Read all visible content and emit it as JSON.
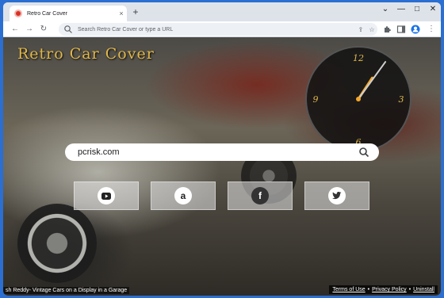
{
  "browser": {
    "tab_title": "Retro Car Cover",
    "tab_close": "×",
    "new_tab": "+",
    "minimize": "—",
    "maximize": "□",
    "close": "✕",
    "address_placeholder": "Search Retro Car Cover or type a URL"
  },
  "page": {
    "title": "Retro Car Cover",
    "search_value": "pcrisk.com",
    "clock": {
      "numerals": [
        "12",
        "3",
        "6",
        "9"
      ],
      "hour": 1,
      "minute": 6
    },
    "tiles": [
      {
        "name": "youtube",
        "icon": "youtube-icon"
      },
      {
        "name": "amazon",
        "icon": "amazon-icon",
        "glyph": "a"
      },
      {
        "name": "facebook",
        "icon": "facebook-icon",
        "glyph": "f"
      },
      {
        "name": "twitter",
        "icon": "twitter-icon"
      }
    ],
    "photo_credit": "sh Reddy- Vintage Cars on a Display in a Garage",
    "footer": {
      "terms": "Terms of Use",
      "privacy": "Privacy Policy",
      "uninstall": "Uninstall",
      "separator": "•"
    }
  },
  "colors": {
    "title_gold": "#e1b84a",
    "clock_hand": "#f4a62a",
    "browser_frame": "#2a6fd1"
  }
}
